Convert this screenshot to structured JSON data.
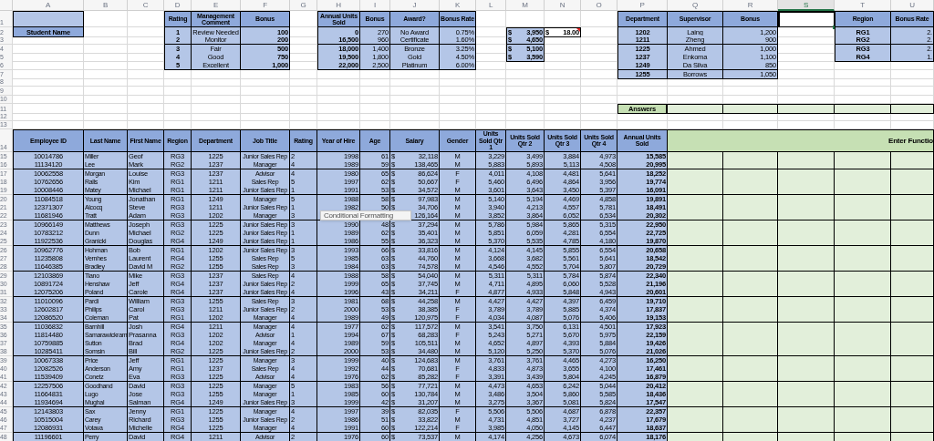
{
  "column_headers": [
    {
      "label": "A",
      "selected": false
    },
    {
      "label": "B",
      "selected": false
    },
    {
      "label": "C",
      "selected": false
    },
    {
      "label": "D",
      "selected": false
    },
    {
      "label": "E",
      "selected": false
    },
    {
      "label": "F",
      "selected": false
    },
    {
      "label": "G",
      "selected": false
    },
    {
      "label": "H",
      "selected": false
    },
    {
      "label": "I",
      "selected": false
    },
    {
      "label": "J",
      "selected": false
    },
    {
      "label": "K",
      "selected": false
    },
    {
      "label": "L",
      "selected": false
    },
    {
      "label": "M",
      "selected": false
    },
    {
      "label": "N",
      "selected": false
    },
    {
      "label": "O",
      "selected": false
    },
    {
      "label": "P",
      "selected": false
    },
    {
      "label": "Q",
      "selected": false
    },
    {
      "label": "R",
      "selected": false
    },
    {
      "label": "S",
      "selected": true
    },
    {
      "label": "T",
      "selected": false
    },
    {
      "label": "U",
      "selected": false
    }
  ],
  "row_numbers": [
    "1",
    "2",
    "3",
    "4",
    "5",
    "6",
    "7",
    "8",
    "9",
    "10",
    "11",
    "12",
    "13",
    "14",
    "15",
    "16",
    "17",
    "18",
    "19",
    "20",
    "21",
    "22",
    "23",
    "24",
    "25",
    "26",
    "27",
    "28",
    "29",
    "30",
    "31",
    "32",
    "33",
    "34",
    "35",
    "36",
    "37",
    "38",
    "39",
    "40",
    "41",
    "42",
    "43",
    "44",
    "45",
    "46",
    "47",
    "48"
  ],
  "student_name": {
    "header": "Student Name"
  },
  "rating_table": {
    "columns": [
      "Rating",
      "Management Comment",
      "Bonus"
    ],
    "rows": [
      [
        "1",
        "Review Needed",
        "100"
      ],
      [
        "2",
        "Monitor",
        "200"
      ],
      [
        "3",
        "Fair",
        "500"
      ],
      [
        "4",
        "Good",
        "750"
      ],
      [
        "5",
        "Excellent",
        "1,000"
      ]
    ]
  },
  "award_table": {
    "columns": [
      "Annual Units Sold",
      "Bonus",
      "Award?",
      "Bonus Rate"
    ],
    "rows": [
      [
        "0",
        "270",
        "No Award",
        "0.75%"
      ],
      [
        "16,500",
        "960",
        "Certificate",
        "1.60%"
      ],
      [
        "18,000",
        "1,400",
        "Bronze",
        "3.25%"
      ],
      [
        "19,500",
        "1,800",
        "Gold",
        "4.50%"
      ],
      [
        "22,000",
        "2,500",
        "Platinum",
        "6.00%"
      ]
    ]
  },
  "price_list": [
    {
      "currency": "$",
      "amount": "3,950"
    },
    {
      "currency": "$",
      "amount": "4,650"
    },
    {
      "currency": "$",
      "amount": "5,100"
    },
    {
      "currency": "$",
      "amount": "3,590"
    }
  ],
  "rate_cell": {
    "currency": "$",
    "amount": "18.00",
    "has_comment": true
  },
  "department_table": {
    "columns": [
      "Department",
      "Supervisor",
      "Bonus"
    ],
    "rows": [
      [
        "1202",
        "Laing",
        "1,200"
      ],
      [
        "1211",
        "Zheng",
        "900"
      ],
      [
        "1225",
        "Ahmed",
        "1,000"
      ],
      [
        "1237",
        "Enkoma",
        "1,100"
      ],
      [
        "1249",
        "Da Silva",
        "850"
      ],
      [
        "1255",
        "Borrows",
        "1,050"
      ]
    ]
  },
  "region_table": {
    "columns": [
      "Region",
      "Bonus Rate"
    ],
    "rows": [
      [
        "RG1",
        "2."
      ],
      [
        "RG2",
        "2."
      ],
      [
        "RG3",
        "2."
      ],
      [
        "RG4",
        "1."
      ]
    ]
  },
  "answers": {
    "label": "Answers"
  },
  "employee_table": {
    "columns": [
      "Employee ID",
      "Last Name",
      "First Name",
      "Region",
      "Department",
      "Job Title",
      "Rating",
      "Year of Hire",
      "Age",
      "Salary",
      "Gender",
      "Units Sold Qtr 1",
      "Units Sold Qtr 2",
      "Units Sold Qtr 3",
      "Units Sold Qtr 4",
      "Annual Units Sold"
    ],
    "rows": [
      [
        "10014786",
        "Miller",
        "Geof",
        "RG3",
        "1225",
        "Junior Sales Rep",
        "2",
        "1998",
        "61",
        {
          "currency": "$",
          "amount": "32,118"
        },
        "M",
        "3,229",
        "3,499",
        "3,884",
        "4,973",
        "15,585"
      ],
      [
        "11134120",
        "Lee",
        "Mark",
        "RG2",
        "1237",
        "Manager",
        "4",
        "1989",
        "59",
        {
          "currency": "$",
          "amount": "138,465"
        },
        "M",
        "5,883",
        "5,893",
        "5,113",
        "4,508",
        "20,995"
      ],
      [
        "10062558",
        "Morgan",
        "Louise",
        "RG3",
        "1237",
        "Advisor",
        "4",
        "1980",
        "65",
        {
          "currency": "$",
          "amount": "86,624"
        },
        "F",
        "4,011",
        "4,108",
        "4,481",
        "5,641",
        "18,252"
      ],
      [
        "10762656",
        "Ralls",
        "Kim",
        "RG1",
        "1211",
        "Sales Rep",
        "5",
        "1997",
        "62",
        {
          "currency": "$",
          "amount": "50,667"
        },
        "F",
        "5,460",
        "6,496",
        "4,864",
        "3,956",
        "19,774"
      ],
      [
        "10008446",
        "Matey",
        "Michael",
        "RG1",
        "1211",
        "Junior Sales Rep",
        "1",
        "1991",
        "53",
        {
          "currency": "$",
          "amount": "34,572"
        },
        "M",
        "3,601",
        "3,643",
        "3,450",
        "5,397",
        "16,091"
      ],
      [
        "11084518",
        "Young",
        "Jonathan",
        "RG1",
        "1249",
        "Manager",
        "5",
        "1988",
        "58",
        {
          "currency": "$",
          "amount": "97,983"
        },
        "M",
        "5,140",
        "5,194",
        "4,469",
        "4,858",
        "19,891"
      ],
      [
        "12371307",
        "Alcocq",
        "Steve",
        "RG3",
        "1211",
        "Junior Sales Rep",
        "1",
        "1982",
        "50",
        {
          "currency": "$",
          "amount": "34,706"
        },
        "M",
        "3,940",
        "4,213",
        "4,557",
        "5,781",
        "18,491"
      ],
      [
        "11681946",
        "Tratt",
        "Adam",
        "RG3",
        "1202",
        "Manager",
        "3",
        null,
        null,
        {
          "amount": "126,164"
        },
        "M",
        "3,852",
        "3,864",
        "6,052",
        "6,534",
        "20,302"
      ],
      [
        "10966149",
        "Matthews",
        "Joseph",
        "RG3",
        "1225",
        "Junior Sales Rep",
        "3",
        "1990",
        "48",
        {
          "currency": "$",
          "amount": "37,294"
        },
        "M",
        "5,786",
        "5,984",
        "5,865",
        "5,315",
        "22,950"
      ],
      [
        "10783212",
        "Dunn",
        "Michael",
        "RG2",
        "1225",
        "Junior Sales Rep",
        "1",
        "1989",
        "62",
        {
          "currency": "$",
          "amount": "35,401"
        },
        "M",
        "5,851",
        "6,059",
        "4,281",
        "6,554",
        "22,725"
      ],
      [
        "11922536",
        "Granicki",
        "Douglas",
        "RG4",
        "1249",
        "Junior Sales Rep",
        "1",
        "1986",
        "55",
        {
          "currency": "$",
          "amount": "36,323"
        },
        "M",
        "5,370",
        "5,535",
        "4,785",
        "4,180",
        "19,870"
      ],
      [
        "10962776",
        "Hohman",
        "Bob",
        "RG1",
        "1202",
        "Junior Sales Rep",
        "3",
        "1993",
        "66",
        {
          "currency": "$",
          "amount": "33,816"
        },
        "M",
        "4,124",
        "4,145",
        "5,855",
        "6,554",
        "20,658"
      ],
      [
        "11235808",
        "Vernhes",
        "Laurent",
        "RG4",
        "1255",
        "Sales Rep",
        "5",
        "1985",
        "63",
        {
          "currency": "$",
          "amount": "44,760"
        },
        "M",
        "3,668",
        "3,682",
        "5,561",
        "5,641",
        "18,542"
      ],
      [
        "11646385",
        "Bradley",
        "David M",
        "RG2",
        "1255",
        "Sales Rep",
        "3",
        "1984",
        "63",
        {
          "currency": "$",
          "amount": "74,578"
        },
        "M",
        "4,546",
        "4,552",
        "5,704",
        "5,807",
        "20,729"
      ],
      [
        "12103869",
        "Tiano",
        "Mike",
        "RG3",
        "1237",
        "Sales Rep",
        "4",
        "1988",
        "58",
        {
          "currency": "$",
          "amount": "54,040"
        },
        "M",
        "5,311",
        "5,311",
        "5,784",
        "5,874",
        "22,340"
      ],
      [
        "10891724",
        "Henshaw",
        "Jeff",
        "RG4",
        "1237",
        "Junior Sales Rep",
        "2",
        "1999",
        "65",
        {
          "currency": "$",
          "amount": "37,745"
        },
        "M",
        "4,711",
        "4,895",
        "6,060",
        "5,528",
        "21,196"
      ],
      [
        "12075206",
        "Poland",
        "Carole",
        "RG4",
        "1237",
        "Junior Sales Rep",
        "4",
        "1996",
        "43",
        {
          "currency": "$",
          "amount": "34,211"
        },
        "F",
        "4,877",
        "4,933",
        "5,848",
        "4,943",
        "20,601"
      ],
      [
        "11010096",
        "Pardi",
        "William",
        "RG3",
        "1255",
        "Sales Rep",
        "3",
        "1981",
        "68",
        {
          "currency": "$",
          "amount": "44,258"
        },
        "M",
        "4,427",
        "4,427",
        "4,397",
        "6,459",
        "19,710"
      ],
      [
        "12602817",
        "Philips",
        "Carol",
        "RG3",
        "1211",
        "Junior Sales Rep",
        "2",
        "2000",
        "53",
        {
          "currency": "$",
          "amount": "38,385"
        },
        "F",
        "3,789",
        "3,789",
        "5,885",
        "4,374",
        "17,837"
      ],
      [
        "12086520",
        "Coleman",
        "Pat",
        "RG1",
        "1202",
        "Manager",
        "4",
        "1989",
        "49",
        {
          "currency": "$",
          "amount": "120,975"
        },
        "F",
        "4,034",
        "4,087",
        "5,076",
        "5,406",
        "19,153"
      ],
      [
        "11036832",
        "Barnhill",
        "Josh",
        "RG4",
        "1211",
        "Manager",
        "4",
        "1977",
        "62",
        {
          "currency": "$",
          "amount": "117,572"
        },
        "M",
        "3,541",
        "3,750",
        "6,131",
        "4,501",
        "17,923"
      ],
      [
        "11814480",
        "Samarawickram",
        "Prasanna",
        "RG3",
        "1202",
        "Advisor",
        "1",
        "1994",
        "67",
        {
          "currency": "$",
          "amount": "68,283"
        },
        "F",
        "5,243",
        "5,271",
        "5,670",
        "5,975",
        "22,159"
      ],
      [
        "10759885",
        "Sutton",
        "Brad",
        "RG4",
        "1202",
        "Manager",
        "4",
        "1989",
        "59",
        {
          "currency": "$",
          "amount": "105,511"
        },
        "M",
        "4,652",
        "4,897",
        "4,393",
        "5,884",
        "19,426"
      ],
      [
        "10285411",
        "Somsin",
        "Bill",
        "RG2",
        "1225",
        "Junior Sales Rep",
        "2",
        "2000",
        "53",
        {
          "currency": "$",
          "amount": "34,480"
        },
        "M",
        "5,120",
        "5,250",
        "5,370",
        "5,076",
        "21,026"
      ],
      [
        "10067338",
        "Price",
        "Jeff",
        "RG1",
        "1225",
        "Manager",
        "3",
        "1999",
        "40",
        {
          "currency": "$",
          "amount": "124,683"
        },
        "M",
        "3,761",
        "3,761",
        "4,465",
        "4,273",
        "16,250"
      ],
      [
        "12082526",
        "Anderson",
        "Amy",
        "RG1",
        "1237",
        "Sales Rep",
        "4",
        "1992",
        "44",
        {
          "currency": "$",
          "amount": "70,681"
        },
        "F",
        "4,833",
        "4,873",
        "3,655",
        "4,100",
        "17,461"
      ],
      [
        "11539409",
        "Conetz",
        "Eva",
        "RG3",
        "1225",
        "Advisor",
        "4",
        "1976",
        "62",
        {
          "currency": "$",
          "amount": "85,282"
        },
        "F",
        "3,391",
        "3,439",
        "5,804",
        "4,245",
        "16,879"
      ],
      [
        "12257506",
        "Goodhand",
        "David",
        "RG3",
        "1225",
        "Manager",
        "5",
        "1983",
        "56",
        {
          "currency": "$",
          "amount": "77,721"
        },
        "M",
        "4,473",
        "4,653",
        "6,242",
        "5,044",
        "20,412"
      ],
      [
        "11664831",
        "Lugo",
        "Jose",
        "RG3",
        "1255",
        "Manager",
        "1",
        "1985",
        "60",
        {
          "currency": "$",
          "amount": "130,784"
        },
        "M",
        "3,486",
        "3,504",
        "5,860",
        "5,585",
        "18,436"
      ],
      [
        "11934694",
        "Mughal",
        "Salman",
        "RG4",
        "1249",
        "Junior Sales Rep",
        "3",
        "1999",
        "42",
        {
          "currency": "$",
          "amount": "31,207"
        },
        "M",
        "3,275",
        "3,367",
        "5,081",
        "5,824",
        "17,547"
      ],
      [
        "12143803",
        "Sax",
        "Jenny",
        "RG1",
        "1225",
        "Manager",
        "4",
        "1997",
        "39",
        {
          "currency": "$",
          "amount": "82,035"
        },
        "F",
        "5,506",
        "5,506",
        "4,687",
        "6,878",
        "22,357"
      ],
      [
        "10515004",
        "Carey",
        "Richard",
        "RG3",
        "1255",
        "Junior Sales Rep",
        "2",
        "1986",
        "51",
        {
          "currency": "$",
          "amount": "33,822"
        },
        "M",
        "4,731",
        "4,851",
        "3,727",
        "4,237",
        "17,679"
      ],
      [
        "12086931",
        "Votava",
        "Michelle",
        "RG4",
        "1225",
        "Manager",
        "4",
        "1991",
        "60",
        {
          "currency": "$",
          "amount": "122,214"
        },
        "F",
        "3,985",
        "4,050",
        "4,145",
        "6,447",
        "18,637"
      ],
      [
        "11196601",
        "Perry",
        "David",
        "RG4",
        "1211",
        "Advisor",
        "2",
        "1976",
        "60",
        {
          "currency": "$",
          "amount": "73,537"
        },
        "M",
        "4,174",
        "4,256",
        "4,673",
        "6,074",
        "18,176"
      ]
    ]
  },
  "functions_area": {
    "title": "Enter Functio"
  },
  "tooltip": {
    "text": "Conditional Formatting"
  }
}
